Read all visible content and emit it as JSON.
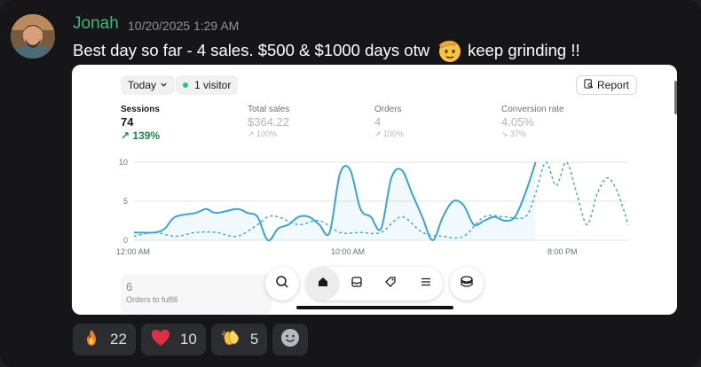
{
  "message": {
    "author": "Jonah",
    "timestamp": "10/20/2025 1:29 AM",
    "text_before": "Best day so far - 4 sales. $500 & $1000 days otw",
    "text_after": "keep grinding !!",
    "inline_emoji": "saluting-face"
  },
  "screenshot": {
    "date_filter": "Today",
    "visitors": "1 visitor",
    "report_label": "Report",
    "metrics": [
      {
        "label": "Sessions",
        "value": "74",
        "change": "139%",
        "direction": "up",
        "active": true
      },
      {
        "label": "Total sales",
        "value": "$364.22",
        "change": "100%",
        "direction": "up",
        "active": false
      },
      {
        "label": "Orders",
        "value": "4",
        "change": "100%",
        "direction": "up",
        "active": false
      },
      {
        "label": "Conversion rate",
        "value": "4.05%",
        "change": "37%",
        "direction": "down",
        "active": false
      }
    ],
    "card": {
      "value": "6",
      "label": "Orders to fulfill"
    },
    "dock_icons": [
      "search-icon",
      "home-icon",
      "inbox-icon",
      "tag-icon",
      "list-icon",
      "store-icon"
    ],
    "accent": "#3aa3d6",
    "positive": "#1e8449"
  },
  "chart_data": {
    "type": "line",
    "ylim": [
      0,
      10
    ],
    "yticks": [
      "10",
      "5",
      "0"
    ],
    "xticks": [
      "12:00 AM",
      "10:00 AM",
      "8:00 PM"
    ],
    "x_range_hours": [
      0,
      24
    ],
    "series": [
      {
        "style": "solid",
        "x": [
          0,
          1,
          1.5,
          2,
          3,
          3.5,
          4,
          5,
          5.5,
          6,
          6.5,
          7,
          7.5,
          8,
          8.5,
          9,
          9.5,
          10,
          10.5,
          11,
          11.5,
          12,
          12.5,
          13,
          13.5,
          14,
          14.5,
          15,
          15.5,
          16,
          16.5,
          17,
          17.5,
          18,
          18.5,
          19,
          19.5
        ],
        "y": [
          1,
          1,
          1.5,
          3,
          3.5,
          4,
          3.5,
          4,
          3.5,
          3,
          0,
          1.5,
          2,
          3,
          3,
          2,
          1,
          8.5,
          9,
          4,
          3,
          1.5,
          8,
          9,
          6,
          3,
          0,
          3,
          5,
          4.5,
          2,
          2.5,
          3,
          2.5,
          3,
          6,
          10
        ]
      },
      {
        "style": "dashed",
        "x": [
          0,
          1,
          2,
          3,
          4,
          5,
          6,
          6.5,
          7,
          8,
          9,
          10,
          11,
          12,
          13,
          14,
          15,
          16,
          17,
          18,
          19,
          19.5,
          20,
          20.5,
          21,
          21.5,
          22,
          22.5,
          23,
          23.5,
          24
        ],
        "y": [
          0.5,
          1,
          0.5,
          1,
          1,
          0.5,
          2,
          3,
          3,
          2,
          2.5,
          1,
          1,
          1,
          3,
          1,
          0.5,
          0.5,
          3,
          3,
          3,
          6,
          10,
          7,
          10,
          6,
          2,
          6,
          8,
          6,
          2
        ]
      }
    ]
  },
  "reactions": [
    {
      "emoji": "fire",
      "count": "22"
    },
    {
      "emoji": "red-heart",
      "count": "10"
    },
    {
      "emoji": "clapping-hands",
      "count": "5"
    }
  ]
}
